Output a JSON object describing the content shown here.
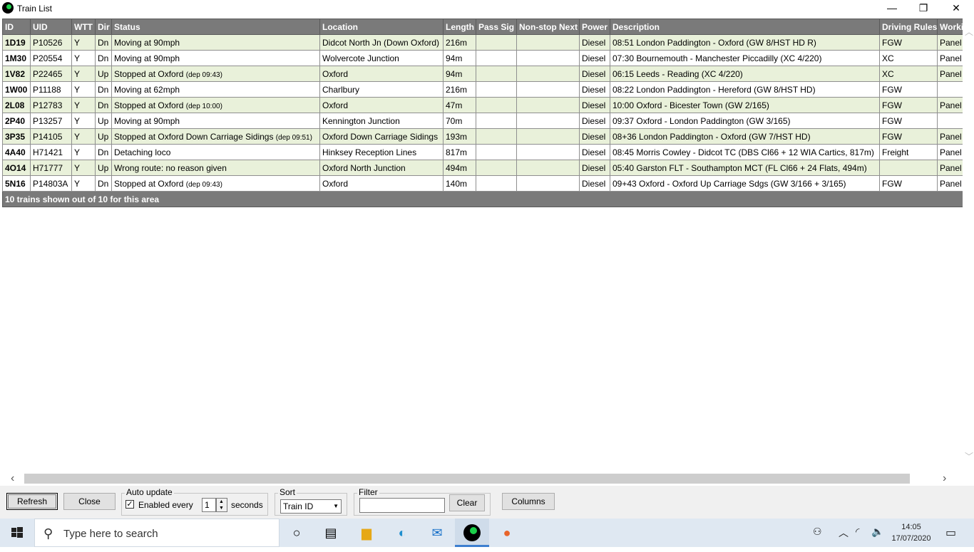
{
  "window": {
    "title": "Train List",
    "minimize_glyph": "—",
    "restore_glyph": "❐",
    "close_glyph": "✕"
  },
  "table": {
    "columns": [
      "ID",
      "UID",
      "WTT",
      "Dir",
      "Status",
      "Location",
      "Length",
      "Pass Sig",
      "Non-stop Next",
      "Power",
      "Description",
      "Driving Rules",
      "Working"
    ],
    "rows": [
      {
        "id": "1D19",
        "uid": "P10526",
        "wtt": "Y",
        "dir": "Dn",
        "status": "Moving at 90mph",
        "status_dep": "",
        "location": "Didcot North Jn (Down Oxford)",
        "length": "216m",
        "pass_sig": "",
        "nonstop": "",
        "power": "Diesel",
        "description": "08:51 London Paddington - Oxford (GW 8/HST HD R)",
        "rules": "FGW",
        "working": "Panel"
      },
      {
        "id": "1M30",
        "uid": "P20554",
        "wtt": "Y",
        "dir": "Dn",
        "status": "Moving at 90mph",
        "status_dep": "",
        "location": "Wolvercote Junction",
        "length": "94m",
        "pass_sig": "",
        "nonstop": "",
        "power": "Diesel",
        "description": "07:30 Bournemouth - Manchester Piccadilly (XC 4/220)",
        "rules": "XC",
        "working": "Panel"
      },
      {
        "id": "1V82",
        "uid": "P22465",
        "wtt": "Y",
        "dir": "Up",
        "status": "Stopped at Oxford",
        "status_dep": "(dep 09:43)",
        "location": "Oxford",
        "length": "94m",
        "pass_sig": "",
        "nonstop": "",
        "power": "Diesel",
        "description": "06:15 Leeds - Reading (XC 4/220)",
        "rules": "XC",
        "working": "Panel"
      },
      {
        "id": "1W00",
        "uid": "P11188",
        "wtt": "Y",
        "dir": "Dn",
        "status": "Moving at 62mph",
        "status_dep": "",
        "location": "Charlbury",
        "length": "216m",
        "pass_sig": "",
        "nonstop": "",
        "power": "Diesel",
        "description": "08:22 London Paddington - Hereford (GW 8/HST HD)",
        "rules": "FGW",
        "working": ""
      },
      {
        "id": "2L08",
        "uid": "P12783",
        "wtt": "Y",
        "dir": "Dn",
        "status": "Stopped at Oxford",
        "status_dep": "(dep 10:00)",
        "location": "Oxford",
        "length": "47m",
        "pass_sig": "",
        "nonstop": "",
        "power": "Diesel",
        "description": "10:00 Oxford - Bicester Town (GW 2/165)",
        "rules": "FGW",
        "working": "Panel"
      },
      {
        "id": "2P40",
        "uid": "P13257",
        "wtt": "Y",
        "dir": "Up",
        "status": "Moving at 90mph",
        "status_dep": "",
        "location": "Kennington Junction",
        "length": "70m",
        "pass_sig": "",
        "nonstop": "",
        "power": "Diesel",
        "description": "09:37 Oxford - London Paddington (GW 3/165)",
        "rules": "FGW",
        "working": ""
      },
      {
        "id": "3P35",
        "uid": "P14105",
        "wtt": "Y",
        "dir": "Up",
        "status": "Stopped at Oxford Down Carriage Sidings",
        "status_dep": "(dep 09:51)",
        "location": "Oxford Down Carriage Sidings",
        "length": "193m",
        "pass_sig": "",
        "nonstop": "",
        "power": "Diesel",
        "description": "08+36 London Paddington - Oxford (GW 7/HST HD)",
        "rules": "FGW",
        "working": "Panel"
      },
      {
        "id": "4A40",
        "uid": "H71421",
        "wtt": "Y",
        "dir": "Dn",
        "status": "Detaching loco",
        "status_dep": "",
        "location": "Hinksey Reception Lines",
        "length": "817m",
        "pass_sig": "",
        "nonstop": "",
        "power": "Diesel",
        "description": "08:45 Morris Cowley - Didcot TC (DBS Cl66 + 12 WIA Cartics, 817m)",
        "rules": "Freight",
        "working": "Panel"
      },
      {
        "id": "4O14",
        "uid": "H71777",
        "wtt": "Y",
        "dir": "Up",
        "status": "Wrong route: no reason given",
        "status_dep": "",
        "location": "Oxford North Junction",
        "length": "494m",
        "pass_sig": "",
        "nonstop": "",
        "power": "Diesel",
        "description": "05:40 Garston FLT - Southampton MCT (FL Cl66 + 24 Flats, 494m)",
        "rules": "",
        "working": "Panel"
      },
      {
        "id": "5N16",
        "uid": "P14803A",
        "wtt": "Y",
        "dir": "Dn",
        "status": "Stopped at Oxford",
        "status_dep": "(dep 09:43)",
        "location": "Oxford",
        "length": "140m",
        "pass_sig": "",
        "nonstop": "",
        "power": "Diesel",
        "description": "09+43 Oxford - Oxford Up Carriage Sdgs (GW 3/166 + 3/165)",
        "rules": "FGW",
        "working": "Panel"
      }
    ],
    "footer": "10 trains shown out of 10 for this area"
  },
  "controls": {
    "refresh_label": "Refresh",
    "close_label": "Close",
    "auto_update_label": "Auto update",
    "enabled_label": "Enabled every",
    "enabled_checked": true,
    "interval_value": "1",
    "seconds_label": "seconds",
    "sort_label": "Sort",
    "sort_value": "Train ID",
    "filter_label": "Filter",
    "filter_value": "",
    "clear_label": "Clear",
    "columns_label": "Columns"
  },
  "taskbar": {
    "search_placeholder": "Type here to search",
    "time": "14:05",
    "date": "17/07/2020",
    "icons": [
      "windows-start-icon",
      "search-icon",
      "cortana-icon",
      "task-view-icon",
      "file-explorer-icon",
      "edge-icon",
      "mail-icon",
      "simsig-icon",
      "firefox-icon",
      "people-icon",
      "chevron-up-icon",
      "network-icon",
      "volume-icon",
      "notification-icon"
    ]
  },
  "colors": {
    "header_bg": "#7a7a7a",
    "row_alt_bg": "#e9f1da",
    "row_bg": "#ffffff",
    "taskbar_bg": "#dfe8f2"
  }
}
